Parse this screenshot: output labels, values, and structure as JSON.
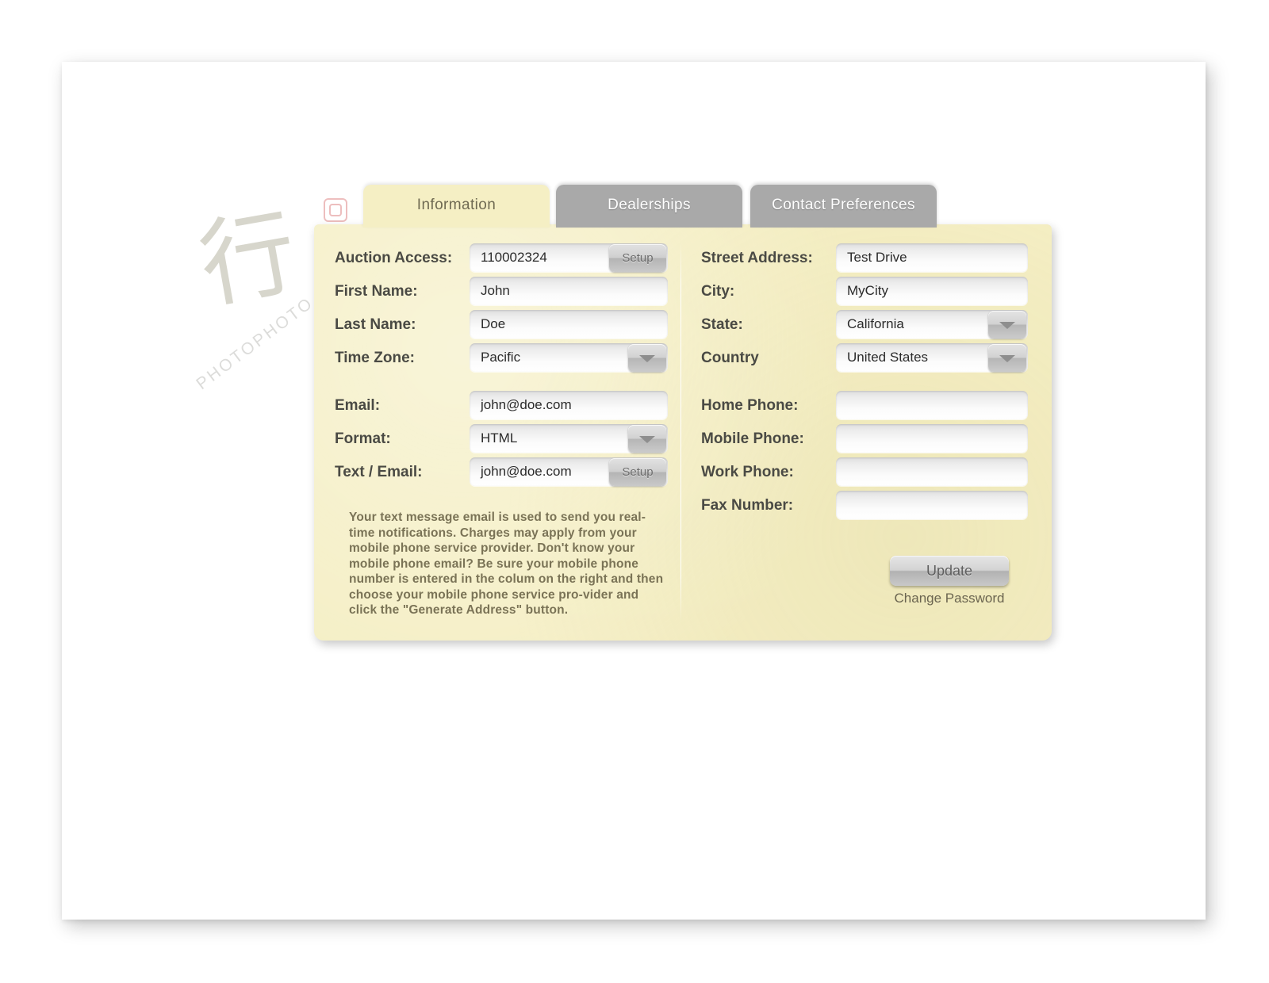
{
  "tabs": [
    {
      "label": "Information",
      "active": true
    },
    {
      "label": "Dealerships",
      "active": false
    },
    {
      "label": "Contact Preferences",
      "active": false
    }
  ],
  "left_column": {
    "fields": [
      {
        "label": "Auction Access:",
        "value": "110002324",
        "type": "text-with-button",
        "button": "Setup"
      },
      {
        "label": "First Name:",
        "value": "John",
        "type": "text"
      },
      {
        "label": "Last Name:",
        "value": "Doe",
        "type": "text"
      },
      {
        "label": "Time Zone:",
        "value": "Pacific",
        "type": "select"
      }
    ],
    "fields2": [
      {
        "label": "Email:",
        "value": "john@doe.com",
        "type": "text"
      },
      {
        "label": "Format:",
        "value": "HTML",
        "type": "select"
      },
      {
        "label": "Text / Email:",
        "value": "john@doe.com",
        "type": "text-with-button",
        "button": "Setup"
      }
    ],
    "help_text": "Your text message email is used to send you real-time notifications. Charges may apply from your mobile phone service provider. Don't know your mobile phone email? Be sure your mobile phone number is entered in the colum on the right and then choose your mobile phone service pro-vider and click the \"Generate Address\" button."
  },
  "right_column": {
    "fields": [
      {
        "label": "Street Address:",
        "value": "Test Drive",
        "type": "text"
      },
      {
        "label": "City:",
        "value": "MyCity",
        "type": "text"
      },
      {
        "label": "State:",
        "value": "California",
        "type": "select"
      },
      {
        "label": "Country",
        "value": "United States",
        "type": "select"
      }
    ],
    "fields2": [
      {
        "label": "Home Phone:",
        "value": "",
        "type": "text"
      },
      {
        "label": "Mobile Phone:",
        "value": "",
        "type": "text"
      },
      {
        "label": "Work Phone:",
        "value": "",
        "type": "text"
      },
      {
        "label": "Fax Number:",
        "value": "",
        "type": "text"
      }
    ],
    "update_button": "Update",
    "change_password_link": "Change Password"
  },
  "watermark": {
    "text": "PHOTOPHOTO.CN",
    "glyph": "行"
  },
  "colors": {
    "panel_bg": "#f5efc4",
    "tab_active_bg": "#f5efc4",
    "tab_inactive_bg": "#a9a9a9",
    "label_text": "#4a4a44",
    "help_text": "#7a7356",
    "page_bg": "#ffffff"
  }
}
